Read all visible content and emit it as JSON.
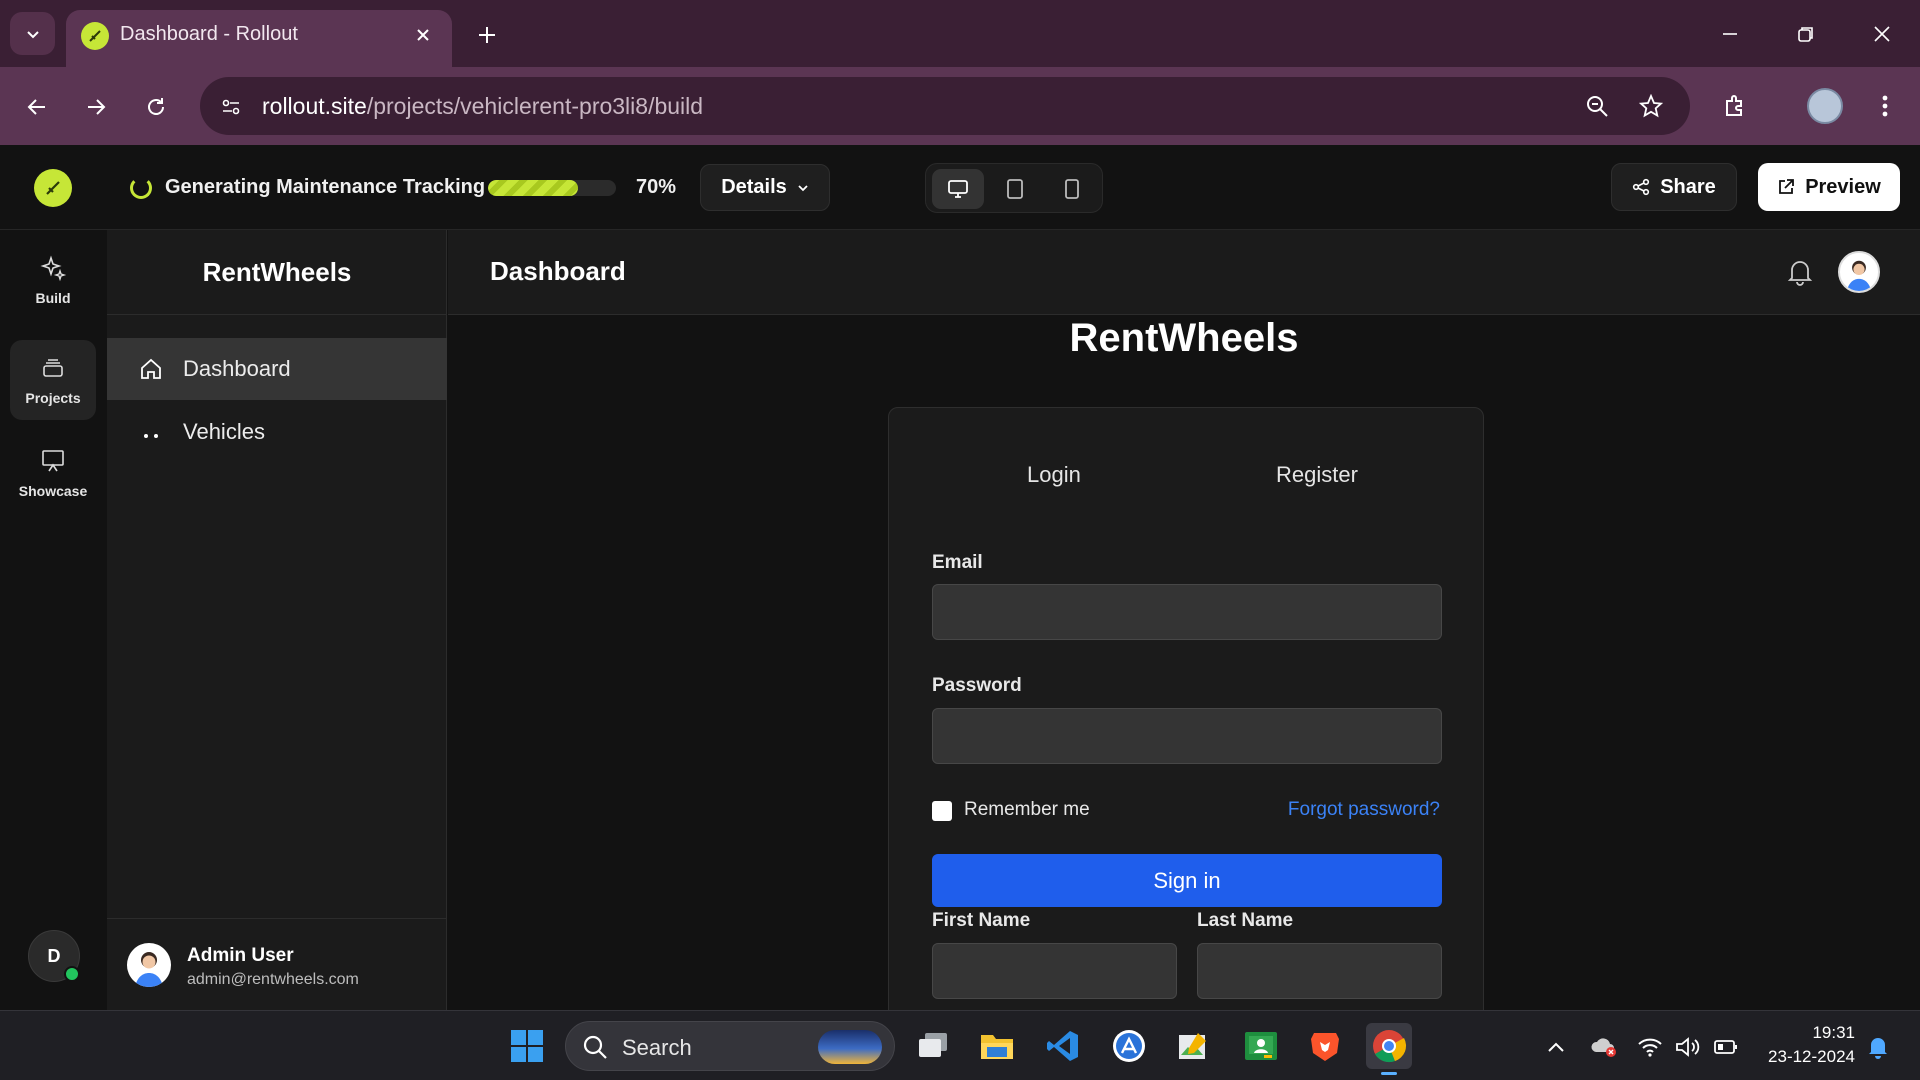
{
  "browser": {
    "tab_title": "Dashboard - Rollout",
    "url_host": "rollout.site",
    "url_path": "/projects/vehiclerent-pro3li8/build"
  },
  "header": {
    "status_text": "Generating Maintenance Tracking",
    "progress_fraction": 0.7,
    "progress_label": "70%",
    "details_label": "Details",
    "share_label": "Share",
    "preview_label": "Preview"
  },
  "rail": {
    "items": [
      {
        "label": "Build",
        "icon": "sparkles-icon"
      },
      {
        "label": "Projects",
        "icon": "layers-icon"
      },
      {
        "label": "Showcase",
        "icon": "presentation-icon"
      }
    ],
    "avatar_letter": "D"
  },
  "sidebar": {
    "brand": "RentWheels",
    "items": [
      {
        "label": "Dashboard",
        "icon": "home-icon"
      },
      {
        "label": "Vehicles",
        "icon": "dots-icon"
      }
    ],
    "user_name": "Admin User",
    "user_email": "admin@rentwheels.com"
  },
  "main": {
    "header_title": "Dashboard",
    "app_title": "RentWheels",
    "auth": {
      "tab_login": "Login",
      "tab_register": "Register",
      "email_label": "Email",
      "password_label": "Password",
      "remember_label": "Remember me",
      "forgot_label": "Forgot password?",
      "signin_label": "Sign in",
      "first_name_label": "First Name",
      "last_name_label": "Last Name"
    }
  },
  "taskbar": {
    "search_label": "Search",
    "time": "19:31",
    "date": "23-12-2024"
  },
  "colors": {
    "accent_lime": "#c6e637",
    "primary_blue": "#1f5eec",
    "link_blue": "#3b82f6",
    "chrome_purple": "#5b3553"
  }
}
